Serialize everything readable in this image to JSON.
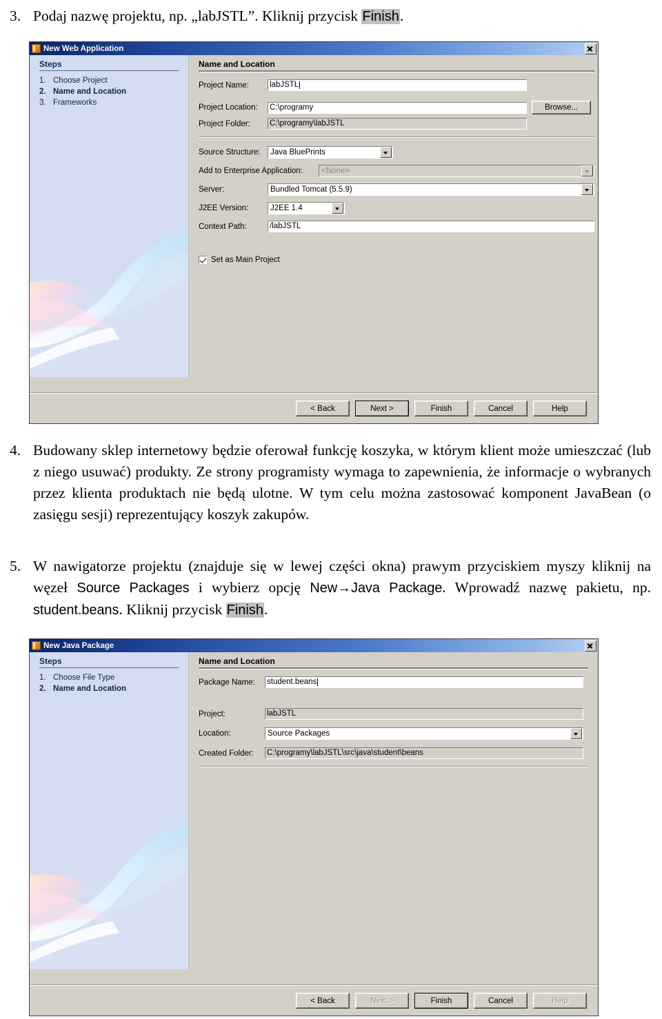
{
  "document": {
    "items": [
      {
        "number": "3.",
        "segments": [
          {
            "t": "Podaj nazwę projektu, np. „labJSTL”. Kliknij przycisk ",
            "style": "serif"
          },
          {
            "t": "Finish",
            "style": "highlight"
          },
          {
            "t": ".",
            "style": "serif"
          }
        ]
      },
      {
        "number": "4.",
        "segments": [
          {
            "t": "Budowany sklep internetowy będzie oferował funkcję koszyka, w którym klient może umieszczać (lub z niego usuwać) produkty. Ze strony programisty wymaga to zapewnienia, że informacje o wybranych przez klienta produktach nie będą ulotne. W tym celu można zastosować komponent JavaBean (o zasięgu sesji) reprezentujący koszyk zakupów.",
            "style": "serif"
          }
        ]
      },
      {
        "number": "5.",
        "segments": [
          {
            "t": "W nawigatorze projektu (znajduje się w lewej części okna) prawym przyciskiem myszy kliknij na węzeł ",
            "style": "serif"
          },
          {
            "t": "Source Packages",
            "style": "ui"
          },
          {
            "t": " i wybierz opcję ",
            "style": "serif"
          },
          {
            "t": "New→Java Package",
            "style": "ui"
          },
          {
            "t": ". Wprowadź nazwę pakietu, np. ",
            "style": "serif"
          },
          {
            "t": "student.beans",
            "style": "ui"
          },
          {
            "t": ". Kliknij przycisk ",
            "style": "serif"
          },
          {
            "t": "Finish",
            "style": "highlight"
          },
          {
            "t": ".",
            "style": "serif"
          }
        ]
      }
    ]
  },
  "colors": {
    "titlebar_start": "#0a246a",
    "titlebar_end": "#b6d0f2",
    "dialog_face": "#d4d0c8",
    "steps_pane": "#d3dcf0",
    "highlight": "#c0c0c0"
  },
  "dialog1": {
    "title": "New Web Application",
    "window_icon": "document-icon",
    "close_icon": "close-icon",
    "steps_heading": "Steps",
    "steps": [
      {
        "n": "1.",
        "label": "Choose Project",
        "current": false
      },
      {
        "n": "2.",
        "label": "Name and Location",
        "current": true
      },
      {
        "n": "3.",
        "label": "Frameworks",
        "current": false
      }
    ],
    "pane_title": "Name and Location",
    "fields": {
      "project_name_label": "Project Name:",
      "project_name_value": "labJSTL",
      "project_location_label": "Project Location:",
      "project_location_value": "C:\\programy",
      "browse_label": "Browse...",
      "project_folder_label": "Project Folder:",
      "project_folder_value": "C:\\programy\\labJSTL",
      "source_structure_label": "Source Structure:",
      "source_structure_value": "Java BluePrints",
      "enterprise_app_label": "Add to Enterprise Application:",
      "enterprise_app_value": "<None>",
      "server_label": "Server:",
      "server_value": "Bundled Tomcat (5.5.9)",
      "j2ee_label": "J2EE Version:",
      "j2ee_value": "J2EE 1.4",
      "context_path_label": "Context Path:",
      "context_path_value": "/labJSTL",
      "set_main_project_label": "Set as Main Project",
      "set_main_project_checked": true
    },
    "buttons": [
      {
        "label": "< Back",
        "state": "enabled"
      },
      {
        "label": "Next >",
        "state": "default"
      },
      {
        "label": "Finish",
        "state": "enabled"
      },
      {
        "label": "Cancel",
        "state": "enabled"
      },
      {
        "label": "Help",
        "state": "enabled"
      }
    ]
  },
  "dialog2": {
    "title": "New Java Package",
    "window_icon": "document-icon",
    "close_icon": "close-icon",
    "steps_heading": "Steps",
    "steps": [
      {
        "n": "1.",
        "label": "Choose File Type",
        "current": false
      },
      {
        "n": "2.",
        "label": "Name and Location",
        "current": true
      }
    ],
    "pane_title": "Name and Location",
    "fields": {
      "package_name_label": "Package Name:",
      "package_name_value": "student.beans",
      "project_label": "Project:",
      "project_value": "labJSTL",
      "location_label": "Location:",
      "location_value": "Source Packages",
      "created_folder_label": "Created Folder:",
      "created_folder_value": "C:\\programy\\labJSTL\\src\\java\\student\\beans"
    },
    "buttons": [
      {
        "label": "< Back",
        "state": "enabled"
      },
      {
        "label": "Next >",
        "state": "disabled"
      },
      {
        "label": "Finish",
        "state": "default"
      },
      {
        "label": "Cancel",
        "state": "enabled"
      },
      {
        "label": "Help",
        "state": "disabled"
      }
    ]
  }
}
